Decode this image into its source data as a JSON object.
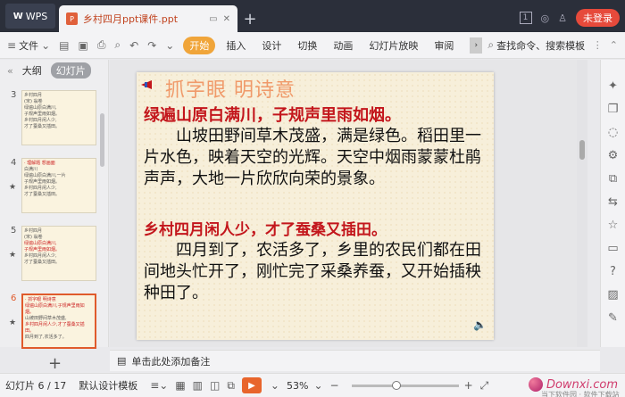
{
  "app": {
    "name": "WPS",
    "doc_tab": "乡村四月ppt课件.ppt",
    "new_tab": "+",
    "login": "未登录",
    "badge": "1"
  },
  "ribbon": {
    "file": "文件",
    "start": "开始",
    "tabs": [
      "插入",
      "设计",
      "切换",
      "动画",
      "幻灯片放映",
      "审阅"
    ],
    "search": "查找命令、搜索模板"
  },
  "left_panel": {
    "outline_tab": "大纲",
    "slides_tab": "幻灯片",
    "thumbnails": [
      {
        "num": "3",
        "lines": [
          "乡村四月",
          "(宋) 翁卷",
          "绿遍山原白满川,",
          "子规声里雨如烟。",
          "乡村四月闲人少,",
          "才了蚕桑又插田。"
        ]
      },
      {
        "num": "4",
        "lines": [
          "· 理解题 想画面",
          "白满川",
          "绿遍山原白满川,一片",
          "子规声里雨如烟。",
          "乡村四月闲人少,",
          "才了蚕桑又插田。"
        ]
      },
      {
        "num": "5",
        "lines": [
          "乡村四月",
          "(宋) 翁卷",
          "绿遍山原白满川,",
          "子规声里雨如烟。",
          "乡村四月闲人少,",
          "才了蚕桑又插田。"
        ]
      },
      {
        "num": "6",
        "lines": [
          "· 抓字眼  明诗意",
          "绿遍山原白满川,子规声里雨如烟。",
          "山坡田野间草木茂盛,",
          "乡村四月闲人少,才了蚕桑又插田。",
          "四月到了,农活多了。"
        ]
      }
    ],
    "add": "+"
  },
  "slide": {
    "title": "抓字眼  明诗意",
    "line1": "绿遍山原白满川，子规声里雨如烟。",
    "para1": "山坡田野间草木茂盛，满是绿色。稻田里一片水色，映着天空的光辉。天空中烟雨蒙蒙杜鹃声声，大地一片欣欣向荣的景象。",
    "line2": "乡村四月闲人少，才了蚕桑又插田。",
    "para2": "四月到了，农活多了，乡里的农民们都在田间地头忙开了，刚忙完了采桑养蚕，又开始插秧种田了。"
  },
  "notes": {
    "placeholder": "单击此处添加备注"
  },
  "status": {
    "slide_counter": "幻灯片 6 / 17",
    "template": "默认设计模板",
    "zoom": "53%",
    "zoom_out": "−",
    "zoom_in": "+",
    "watermark": "Downxi.com",
    "watermark_sub": "当下软件园 · 软件下载站"
  },
  "colors": {
    "accent": "#e8652c",
    "title_red": "#c3161c",
    "slide_bg": "#f7efda"
  }
}
